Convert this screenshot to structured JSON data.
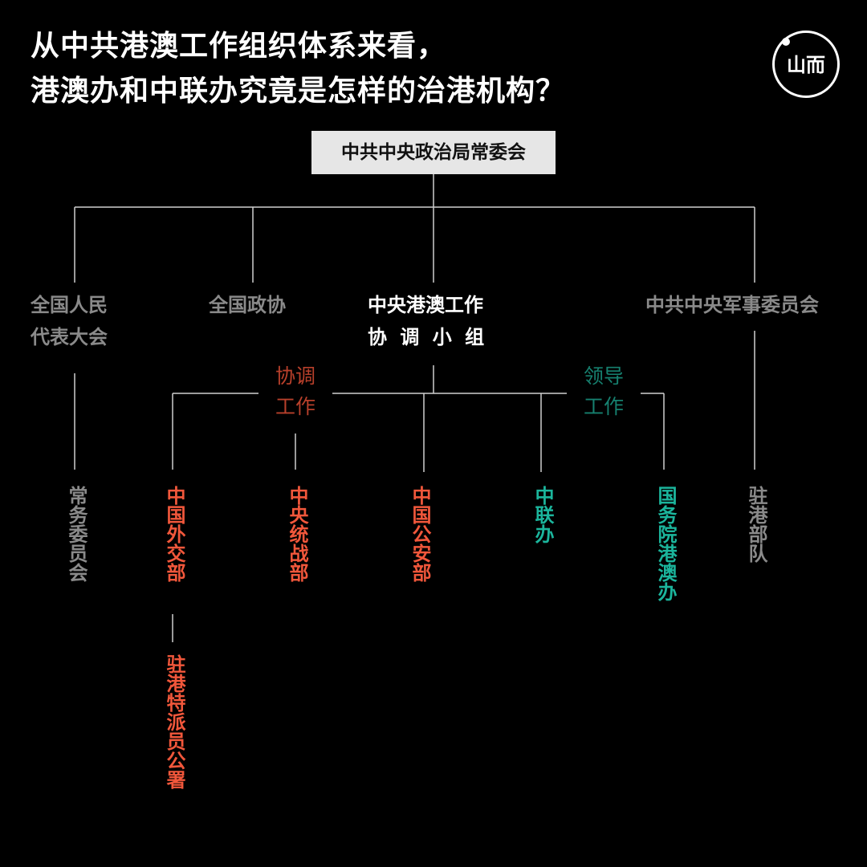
{
  "title": {
    "line1": "从中共港澳工作组织体系来看，",
    "line2": "港澳办和中联办究竟是怎样的治港机构？"
  },
  "logo": {
    "text": "山而"
  },
  "root": "中共中央政治局常委会",
  "level2": {
    "npc_line1": "全国人民",
    "npc_line2": "代表大会",
    "cppcc": "全国政协",
    "group_line1": "中央港澳工作",
    "group_line2": "协 调 小 组",
    "cmc": "中共中央军事委员会"
  },
  "relations": {
    "coord_line1": "协调",
    "coord_line2": "工作",
    "lead_line1": "领导",
    "lead_line2": "工作"
  },
  "level3": {
    "standing": "常务委员会",
    "mfa": "中国外交部",
    "ufwd": "中央统战部",
    "mps": "中国公安部",
    "loo": "中联办",
    "hkmao": "国务院港澳办",
    "garrison": "驻港部队",
    "commissioner": "驻港特派员公署"
  },
  "colors": {
    "background": "#000000",
    "gray": "#8a8a8a",
    "orange": "#f1573b",
    "teal": "#1bb59c",
    "coord_label": "#b8402b",
    "lead_label": "#16806f",
    "line": "#cfcfcf"
  }
}
